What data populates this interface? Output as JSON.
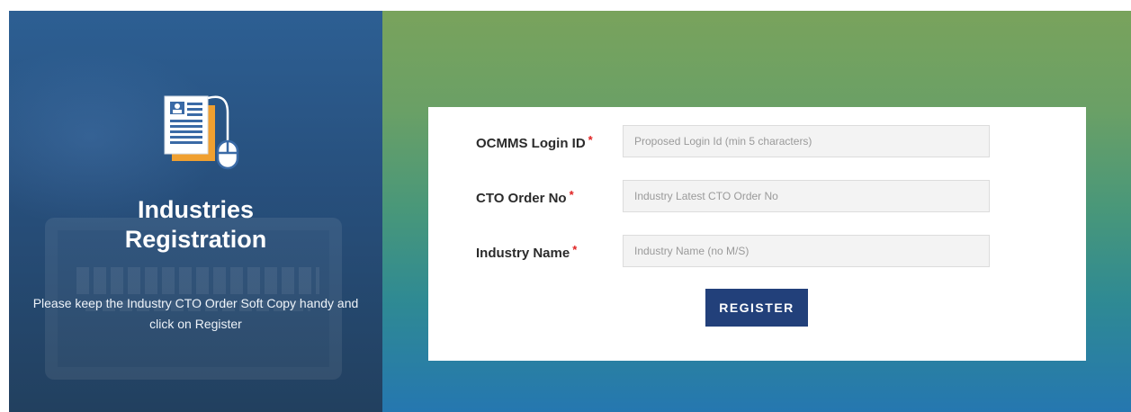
{
  "hero": {
    "title_line1": "Industries",
    "title_line2": "Registration",
    "description": "Please keep the Industry CTO Order Soft Copy handy and click on Register",
    "icon": "document-with-mouse-icon"
  },
  "form": {
    "fields": [
      {
        "label": "OCMMS Login ID",
        "required_mark": "*",
        "placeholder": "Proposed Login Id (min 5 characters)",
        "value": ""
      },
      {
        "label": "CTO Order No",
        "required_mark": "*",
        "placeholder": "Industry Latest CTO Order No",
        "value": ""
      },
      {
        "label": "Industry Name",
        "required_mark": "*",
        "placeholder": "Industry Name (no M/S)",
        "value": ""
      }
    ],
    "submit_label": "REGISTER"
  },
  "colors": {
    "hero_bg": "#2d5f93",
    "button_bg": "#22407a",
    "required": "#e02222",
    "gradient_top": "#79a35c",
    "gradient_bottom": "#2577b0"
  }
}
